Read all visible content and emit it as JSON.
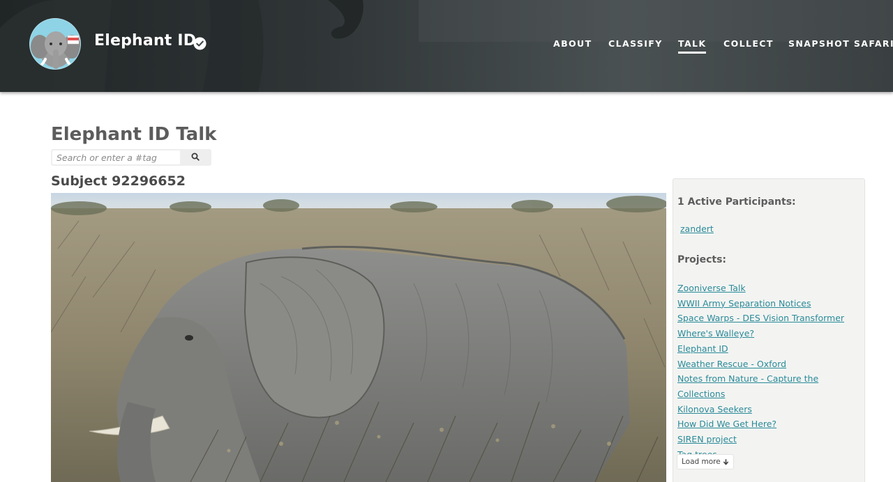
{
  "header": {
    "project_title": "Elephant ID",
    "nav": [
      {
        "label": "ABOUT",
        "active": false
      },
      {
        "label": "CLASSIFY",
        "active": false
      },
      {
        "label": "TALK",
        "active": true
      },
      {
        "label": "COLLECT",
        "active": false
      },
      {
        "label": "SNAPSHOT SAFARI",
        "active": false
      }
    ],
    "avatar_icon": "elephant-icon",
    "verified_icon": "check-circle-icon",
    "colors": {
      "header_bg": "#3d4446",
      "nav_text": "#ffffff"
    }
  },
  "talk": {
    "title": "Elephant ID Talk",
    "search_placeholder": "Search or enter a #tag",
    "search_icon": "search-icon"
  },
  "subject": {
    "title": "Subject 92296652",
    "image_icon": "elephant-photo"
  },
  "sidebar": {
    "participants_heading": "1 Active Participants:",
    "participants": [
      "zandert"
    ],
    "projects_heading": "Projects:",
    "projects": [
      "Zooniverse Talk",
      "WWII Army Separation Notices",
      "Space Warps - DES Vision Transformer",
      "Where's Walleye?",
      "Elephant ID",
      "Weather Rescue - Oxford",
      "Notes from Nature - Capture the Collections",
      "Kilonova Seekers",
      "How Did We Get Here?",
      "SIREN project",
      "Tag trees"
    ],
    "load_more_label": "Load more",
    "load_more_icon": "arrow-down-icon",
    "colors": {
      "link": "#2b8a99",
      "panel_bg": "#f3f4f2"
    }
  }
}
